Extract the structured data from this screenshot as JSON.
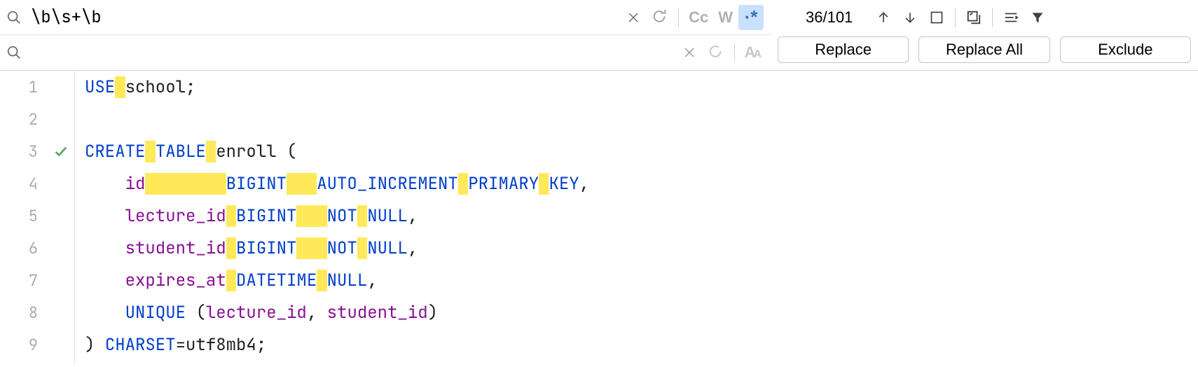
{
  "search": {
    "find_value": "\\b\\s+\\b",
    "replace_value": "",
    "count": "36/101",
    "cc": "Cc",
    "w": "W",
    "regex": ".*",
    "aa": "A",
    "aa2": "A"
  },
  "buttons": {
    "replace": "Replace",
    "replace_all": "Replace All",
    "exclude": "Exclude"
  },
  "gutter": [
    "1",
    "2",
    "3",
    "4",
    "5",
    "6",
    "7",
    "8",
    "9"
  ],
  "code": {
    "l1": {
      "kw": "USE",
      "sp": " ",
      "rest": "school;"
    },
    "l3": {
      "a": "CREATE",
      "s1": " ",
      "b": "TABLE",
      "s2": " ",
      "c": "enroll ("
    },
    "l4": {
      "indent": "    ",
      "col": "id",
      "sp1": "        ",
      "t": "BIGINT",
      "sp2": "   ",
      "ai": "AUTO_INCREMENT",
      "sp3": " ",
      "pk1": "PRIMARY",
      "sp4": " ",
      "pk2": "KEY",
      "p": ","
    },
    "l5": {
      "indent": "    ",
      "col": "lecture_id",
      "sp1": " ",
      "t": "BIGINT",
      "sp2": "   ",
      "nn1": "NOT",
      "sp3": " ",
      "nn2": "NULL",
      "p": ","
    },
    "l6": {
      "indent": "    ",
      "col": "student_id",
      "sp1": " ",
      "t": "BIGINT",
      "sp2": "   ",
      "nn1": "NOT",
      "sp3": " ",
      "nn2": "NULL",
      "p": ","
    },
    "l7": {
      "indent": "    ",
      "col": "expires_at",
      "sp1": " ",
      "t": "DATETIME",
      "sp2": " ",
      "nn": "NULL",
      "p": ","
    },
    "l8": {
      "indent": "    ",
      "u": "UNIQUE",
      "p1": " (",
      "c1": "lecture_id",
      "cm": ", ",
      "c2": "student_id",
      "p2": ")"
    },
    "l9": {
      "p1": ") ",
      "cs": "CHARSET",
      "eq": "=utf8mb4;"
    }
  }
}
